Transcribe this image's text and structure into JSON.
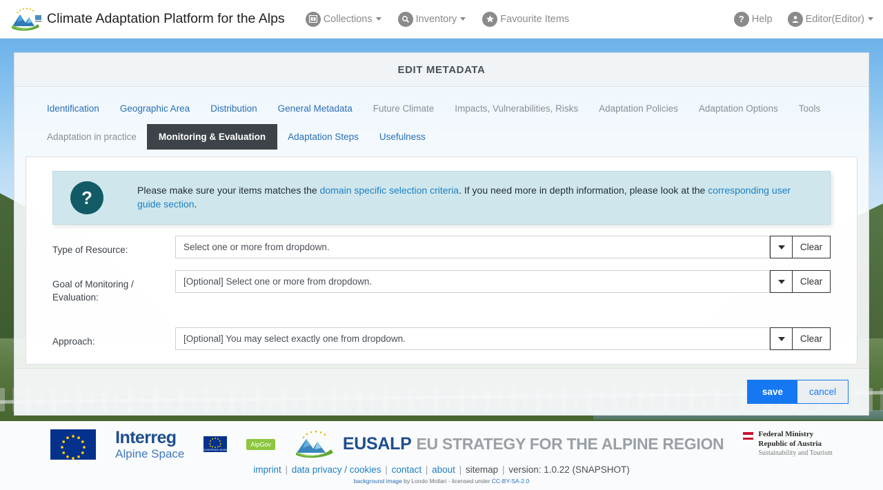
{
  "header": {
    "brand_title": "Climate Adaptation Platform for the Alps",
    "logo_icon": "alpine-mountain-logo",
    "nav": [
      {
        "label": "Collections",
        "icon": "collections-icon",
        "caret": true
      },
      {
        "label": "Inventory",
        "icon": "search-icon",
        "caret": true
      },
      {
        "label": "Favourite Items",
        "icon": "star-icon",
        "caret": false
      }
    ],
    "right_nav": [
      {
        "label": "Help",
        "icon": "question-mark-icon",
        "caret": false
      },
      {
        "label": "Editor(Editor)",
        "icon": "user-icon",
        "caret": true
      }
    ]
  },
  "card": {
    "title": "EDIT METADATA",
    "tabs_row1": [
      {
        "label": "Identification",
        "state": "link"
      },
      {
        "label": "Geographic Area",
        "state": "link"
      },
      {
        "label": "Distribution",
        "state": "link"
      },
      {
        "label": "General Metadata",
        "state": "link"
      },
      {
        "label": "Future Climate",
        "state": "muted"
      },
      {
        "label": "Impacts, Vulnerabilities, Risks",
        "state": "muted"
      },
      {
        "label": "Adaptation Policies",
        "state": "muted"
      },
      {
        "label": "Adaptation Options",
        "state": "muted"
      },
      {
        "label": "Tools",
        "state": "muted"
      }
    ],
    "tabs_row2": [
      {
        "label": "Adaptation in practice",
        "state": "muted"
      },
      {
        "label": "Monitoring & Evaluation",
        "state": "active"
      },
      {
        "label": "Adaptation Steps",
        "state": "link"
      },
      {
        "label": "Usefulness",
        "state": "link"
      }
    ],
    "info": {
      "icon": "question-mark-icon",
      "t1": "Please make sure your items matches the ",
      "link1": "domain specific selection criteria",
      "t2": ". If you need more in depth information, please look at the ",
      "link2": "corresponding user guide section",
      "t3": "."
    },
    "fields": [
      {
        "label": "Type of Resource:",
        "value": "Select one or more from dropdown.",
        "dropdown_icon": "caret-down-icon",
        "clear_label": "Clear"
      },
      {
        "label": "Goal of Monitoring / Evaluation:",
        "value": "[Optional] Select one or more from dropdown.",
        "dropdown_icon": "caret-down-icon",
        "clear_label": "Clear"
      },
      {
        "label": "Approach:",
        "value": "[Optional] You may select exactly one from dropdown.",
        "dropdown_icon": "caret-down-icon",
        "clear_label": "Clear"
      }
    ],
    "save_label": "save",
    "cancel_label": "cancel",
    "accent_color": "#1578f2"
  },
  "footer": {
    "logos": {
      "interreg_line1": "Interreg",
      "interreg_line2": "Alpine Space",
      "eu_caption": "EUROPEAN UNION",
      "alpgov": "AlpGov",
      "eusalp_name": "EUSALP",
      "eusalp_tagline": "EU STRATEGY FOR THE ALPINE REGION",
      "ministry_l1": "Federal Ministry",
      "ministry_l2": "Republic of Austria",
      "ministry_l3": "Sustainability and Tourism"
    },
    "links": [
      {
        "label": "imprint",
        "type": "link"
      },
      {
        "label": "data privacy / cookies",
        "type": "link"
      },
      {
        "label": "contact",
        "type": "link"
      },
      {
        "label": "about",
        "type": "link"
      },
      {
        "label": "sitemap",
        "type": "text"
      },
      {
        "label": "version: 1.0.22 (SNAPSHOT)",
        "type": "text"
      }
    ],
    "credit": {
      "link1": "background image",
      "mid": " by Londo Mollari - licensed under ",
      "link2": "CC-BY-SA-2.0"
    }
  }
}
